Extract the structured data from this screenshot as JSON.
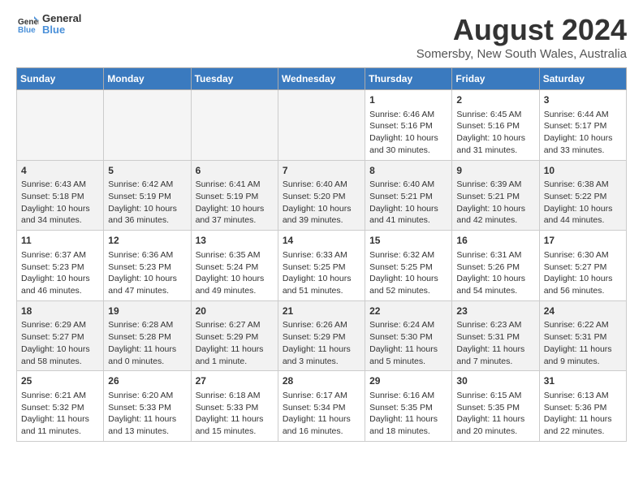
{
  "header": {
    "logo_general": "General",
    "logo_blue": "Blue",
    "main_title": "August 2024",
    "subtitle": "Somersby, New South Wales, Australia"
  },
  "weekdays": [
    "Sunday",
    "Monday",
    "Tuesday",
    "Wednesday",
    "Thursday",
    "Friday",
    "Saturday"
  ],
  "weeks": [
    [
      {
        "day": "",
        "empty": true
      },
      {
        "day": "",
        "empty": true
      },
      {
        "day": "",
        "empty": true
      },
      {
        "day": "",
        "empty": true
      },
      {
        "day": "1",
        "lines": [
          "Sunrise: 6:46 AM",
          "Sunset: 5:16 PM",
          "Daylight: 10 hours",
          "and 30 minutes."
        ]
      },
      {
        "day": "2",
        "lines": [
          "Sunrise: 6:45 AM",
          "Sunset: 5:16 PM",
          "Daylight: 10 hours",
          "and 31 minutes."
        ]
      },
      {
        "day": "3",
        "lines": [
          "Sunrise: 6:44 AM",
          "Sunset: 5:17 PM",
          "Daylight: 10 hours",
          "and 33 minutes."
        ]
      }
    ],
    [
      {
        "day": "4",
        "lines": [
          "Sunrise: 6:43 AM",
          "Sunset: 5:18 PM",
          "Daylight: 10 hours",
          "and 34 minutes."
        ]
      },
      {
        "day": "5",
        "lines": [
          "Sunrise: 6:42 AM",
          "Sunset: 5:19 PM",
          "Daylight: 10 hours",
          "and 36 minutes."
        ]
      },
      {
        "day": "6",
        "lines": [
          "Sunrise: 6:41 AM",
          "Sunset: 5:19 PM",
          "Daylight: 10 hours",
          "and 37 minutes."
        ]
      },
      {
        "day": "7",
        "lines": [
          "Sunrise: 6:40 AM",
          "Sunset: 5:20 PM",
          "Daylight: 10 hours",
          "and 39 minutes."
        ]
      },
      {
        "day": "8",
        "lines": [
          "Sunrise: 6:40 AM",
          "Sunset: 5:21 PM",
          "Daylight: 10 hours",
          "and 41 minutes."
        ]
      },
      {
        "day": "9",
        "lines": [
          "Sunrise: 6:39 AM",
          "Sunset: 5:21 PM",
          "Daylight: 10 hours",
          "and 42 minutes."
        ]
      },
      {
        "day": "10",
        "lines": [
          "Sunrise: 6:38 AM",
          "Sunset: 5:22 PM",
          "Daylight: 10 hours",
          "and 44 minutes."
        ]
      }
    ],
    [
      {
        "day": "11",
        "lines": [
          "Sunrise: 6:37 AM",
          "Sunset: 5:23 PM",
          "Daylight: 10 hours",
          "and 46 minutes."
        ]
      },
      {
        "day": "12",
        "lines": [
          "Sunrise: 6:36 AM",
          "Sunset: 5:23 PM",
          "Daylight: 10 hours",
          "and 47 minutes."
        ]
      },
      {
        "day": "13",
        "lines": [
          "Sunrise: 6:35 AM",
          "Sunset: 5:24 PM",
          "Daylight: 10 hours",
          "and 49 minutes."
        ]
      },
      {
        "day": "14",
        "lines": [
          "Sunrise: 6:33 AM",
          "Sunset: 5:25 PM",
          "Daylight: 10 hours",
          "and 51 minutes."
        ]
      },
      {
        "day": "15",
        "lines": [
          "Sunrise: 6:32 AM",
          "Sunset: 5:25 PM",
          "Daylight: 10 hours",
          "and 52 minutes."
        ]
      },
      {
        "day": "16",
        "lines": [
          "Sunrise: 6:31 AM",
          "Sunset: 5:26 PM",
          "Daylight: 10 hours",
          "and 54 minutes."
        ]
      },
      {
        "day": "17",
        "lines": [
          "Sunrise: 6:30 AM",
          "Sunset: 5:27 PM",
          "Daylight: 10 hours",
          "and 56 minutes."
        ]
      }
    ],
    [
      {
        "day": "18",
        "lines": [
          "Sunrise: 6:29 AM",
          "Sunset: 5:27 PM",
          "Daylight: 10 hours",
          "and 58 minutes."
        ]
      },
      {
        "day": "19",
        "lines": [
          "Sunrise: 6:28 AM",
          "Sunset: 5:28 PM",
          "Daylight: 11 hours",
          "and 0 minutes."
        ]
      },
      {
        "day": "20",
        "lines": [
          "Sunrise: 6:27 AM",
          "Sunset: 5:29 PM",
          "Daylight: 11 hours",
          "and 1 minute."
        ]
      },
      {
        "day": "21",
        "lines": [
          "Sunrise: 6:26 AM",
          "Sunset: 5:29 PM",
          "Daylight: 11 hours",
          "and 3 minutes."
        ]
      },
      {
        "day": "22",
        "lines": [
          "Sunrise: 6:24 AM",
          "Sunset: 5:30 PM",
          "Daylight: 11 hours",
          "and 5 minutes."
        ]
      },
      {
        "day": "23",
        "lines": [
          "Sunrise: 6:23 AM",
          "Sunset: 5:31 PM",
          "Daylight: 11 hours",
          "and 7 minutes."
        ]
      },
      {
        "day": "24",
        "lines": [
          "Sunrise: 6:22 AM",
          "Sunset: 5:31 PM",
          "Daylight: 11 hours",
          "and 9 minutes."
        ]
      }
    ],
    [
      {
        "day": "25",
        "lines": [
          "Sunrise: 6:21 AM",
          "Sunset: 5:32 PM",
          "Daylight: 11 hours",
          "and 11 minutes."
        ]
      },
      {
        "day": "26",
        "lines": [
          "Sunrise: 6:20 AM",
          "Sunset: 5:33 PM",
          "Daylight: 11 hours",
          "and 13 minutes."
        ]
      },
      {
        "day": "27",
        "lines": [
          "Sunrise: 6:18 AM",
          "Sunset: 5:33 PM",
          "Daylight: 11 hours",
          "and 15 minutes."
        ]
      },
      {
        "day": "28",
        "lines": [
          "Sunrise: 6:17 AM",
          "Sunset: 5:34 PM",
          "Daylight: 11 hours",
          "and 16 minutes."
        ]
      },
      {
        "day": "29",
        "lines": [
          "Sunrise: 6:16 AM",
          "Sunset: 5:35 PM",
          "Daylight: 11 hours",
          "and 18 minutes."
        ]
      },
      {
        "day": "30",
        "lines": [
          "Sunrise: 6:15 AM",
          "Sunset: 5:35 PM",
          "Daylight: 11 hours",
          "and 20 minutes."
        ]
      },
      {
        "day": "31",
        "lines": [
          "Sunrise: 6:13 AM",
          "Sunset: 5:36 PM",
          "Daylight: 11 hours",
          "and 22 minutes."
        ]
      }
    ]
  ]
}
